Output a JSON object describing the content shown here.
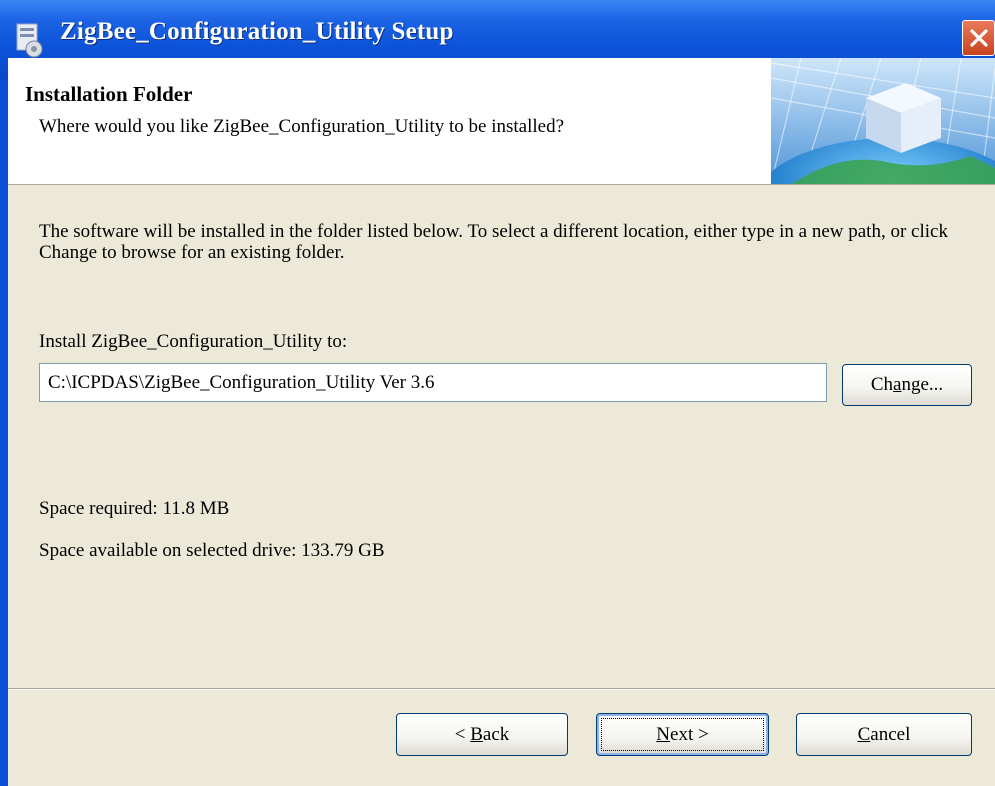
{
  "window": {
    "title": "ZigBee_Configuration_Utility Setup"
  },
  "header": {
    "title": "Installation Folder",
    "subtitle": "Where would you like ZigBee_Configuration_Utility to be installed?"
  },
  "body": {
    "intro": "The software will be installed in the folder listed below. To select a different location, either type in a new path, or click Change to browse for an existing folder.",
    "install_label": "Install ZigBee_Configuration_Utility to:",
    "install_path": "C:\\ICPDAS\\ZigBee_Configuration_Utility Ver 3.6",
    "space_required": "Space required: 11.8 MB",
    "space_available": "Space available on selected drive: 133.79 GB"
  },
  "buttons": {
    "change_prefix": "Ch",
    "change_accel": "a",
    "change_suffix": "nge...",
    "back_prefix": "< ",
    "back_accel": "B",
    "back_suffix": "ack",
    "next_accel": "N",
    "next_suffix": "ext >",
    "cancel_accel": "C",
    "cancel_suffix": "ancel"
  },
  "icons": {
    "app": "installer-icon",
    "close": "close-icon",
    "header": "cube-globe-graphic"
  },
  "colors": {
    "titlebar": "#0b52d8",
    "dialog_bg": "#ece9d8",
    "close_button": "#c9431f"
  }
}
